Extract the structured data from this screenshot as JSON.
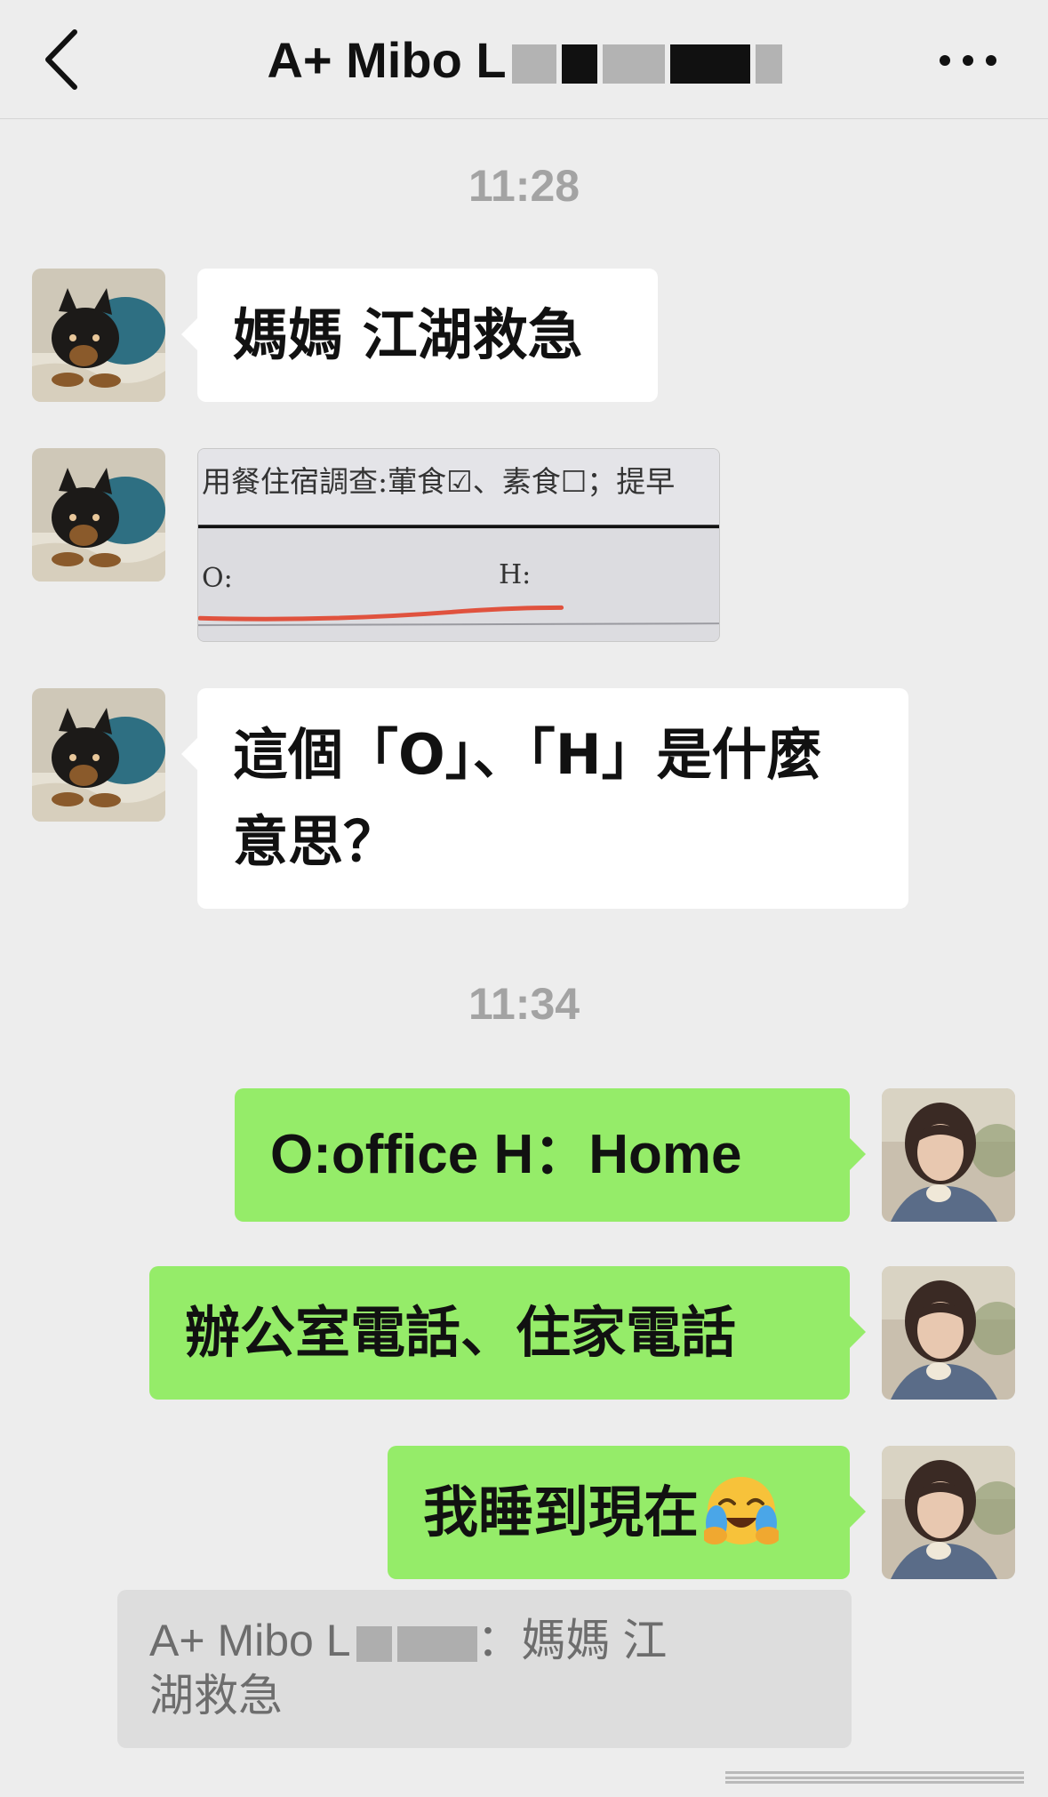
{
  "header": {
    "back_icon": "chevron-left-icon",
    "title": "A+ Mibo L",
    "more_icon": "more-horizontal-icon"
  },
  "messages": {
    "time1": "11:28",
    "in1": "媽媽 江湖救急",
    "image": {
      "line1": "用餐住宿調查:葷食☑、素食☐；提早",
      "o_label": "O:",
      "h_label": "H:"
    },
    "in2_line1": "這個「O」、「H」是什麼",
    "in2_line2": "意思？",
    "time2": "11:34",
    "out1": "O:office H：Home",
    "out2": "辦公室電話、住家電話",
    "out3": "我睡到現在",
    "out3_emoji": "crying-laughing-emoji"
  },
  "quote": {
    "line1_prefix": "A+ Mibo L",
    "line1_suffix": "：媽媽 江",
    "line2": "湖救急"
  },
  "colors": {
    "background": "#ededed",
    "bubble_in": "#ffffff",
    "bubble_out": "#95ec69",
    "timestamp": "#a3a3a3"
  }
}
